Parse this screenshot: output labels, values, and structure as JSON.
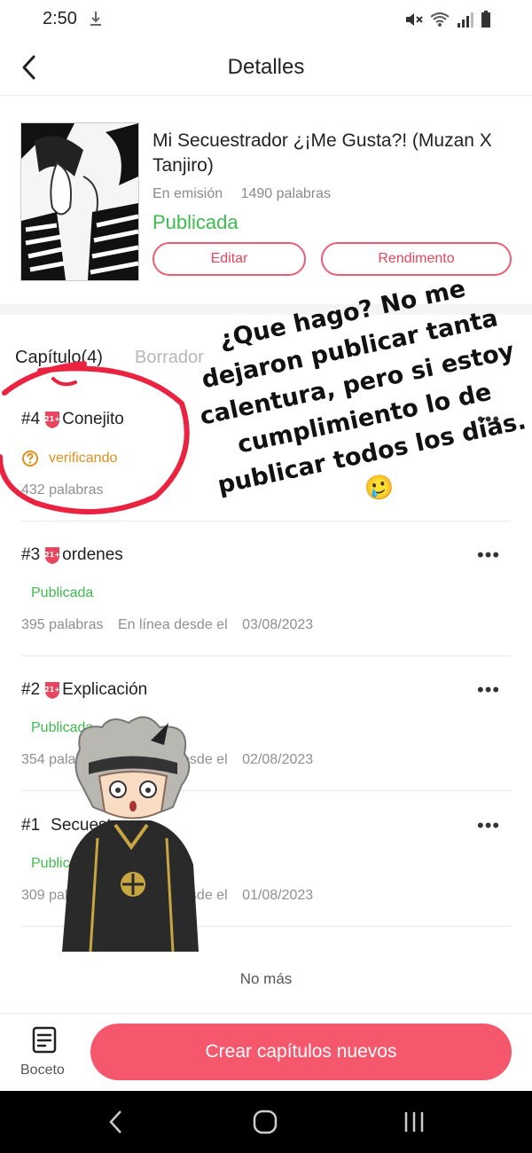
{
  "status_bar": {
    "time": "2:50"
  },
  "header": {
    "title": "Detalles"
  },
  "book": {
    "title": "Mi Secuestrador ¿¡Me Gusta?! (Muzan X Tanjiro)",
    "state": "En emisión",
    "words": "1490 palabras",
    "status": "Publicada",
    "edit_label": "Editar",
    "performance_label": "Rendimento"
  },
  "tabs": {
    "chapters": "Capítulo(4)",
    "drafts": "Borrador"
  },
  "chapters": [
    {
      "number": "#4",
      "name": "Conejito",
      "status": "verificando",
      "words": "432 palabras"
    },
    {
      "number": "#3",
      "name": "ordenes",
      "status": "Publicada",
      "words": "395 palabras",
      "online": "En línea desde el",
      "date": "03/08/2023"
    },
    {
      "number": "#2",
      "name": "Explicación",
      "status": "Publicada",
      "words": "354 palabras",
      "online": "En línea desde el",
      "date": "02/08/2023"
    },
    {
      "number": "#1",
      "name": "Secuestro",
      "status": "Publicada",
      "words": "309 palabras",
      "online": "En línea desde el",
      "date": "01/08/2023"
    }
  ],
  "age_badge": "21+",
  "list_end": "No más",
  "bottom": {
    "draft_label": "Boceto",
    "create_label": "Crear capítulos nuevos"
  },
  "overlay_text": "¿Que hago? No me dejaron publicar tanta calentura, pero si estoy cumplimiento lo de publicar todos los días. 🥲",
  "colors": {
    "accent": "#f5576c",
    "published": "#3dbb4d",
    "verifying": "#e0901b"
  }
}
